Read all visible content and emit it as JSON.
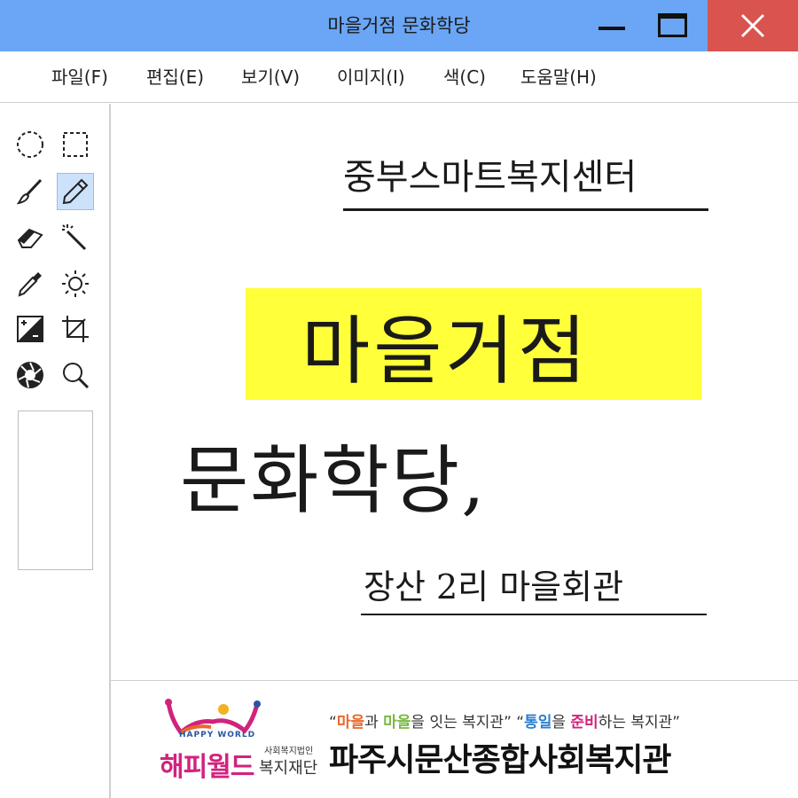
{
  "window": {
    "title": "마을거점 문화학당"
  },
  "menu": [
    {
      "label": "파일(F)"
    },
    {
      "label": "편집(E)"
    },
    {
      "label": "보기(V)"
    },
    {
      "label": "이미지(I)"
    },
    {
      "label": "색(C)"
    },
    {
      "label": "도움말(H)"
    }
  ],
  "tools": [
    {
      "icon": "ellipse-select-icon"
    },
    {
      "icon": "rect-select-icon"
    },
    {
      "icon": "brush-icon"
    },
    {
      "icon": "pencil-icon",
      "active": true
    },
    {
      "icon": "eraser-icon"
    },
    {
      "icon": "magic-wand-icon"
    },
    {
      "icon": "color-picker-icon"
    },
    {
      "icon": "brightness-icon"
    },
    {
      "icon": "contrast-icon"
    },
    {
      "icon": "crop-icon"
    },
    {
      "icon": "aperture-icon"
    },
    {
      "icon": "zoom-icon"
    }
  ],
  "canvas": {
    "center_name": "중부스마트복지센터",
    "headline_1": "마을거점",
    "headline_2": "문화학당,",
    "place": "장산 2리 마을회관",
    "highlight_color": "#ffff3a"
  },
  "footer": {
    "logo_en": "HAPPY WORLD",
    "logo_kr": "해피월드",
    "foundation_small": "사회복지법인",
    "foundation_big": "복지재단",
    "slogan": {
      "q1": "“",
      "w1": "마을",
      "t1": "과 ",
      "w2": "마을",
      "t2": "을 잇는 복지관” “",
      "w3": "통일",
      "t3": "을 ",
      "w4": "준비",
      "t4": "하는 복지관”"
    },
    "org_name": "파주시문산종합사회복지관"
  }
}
